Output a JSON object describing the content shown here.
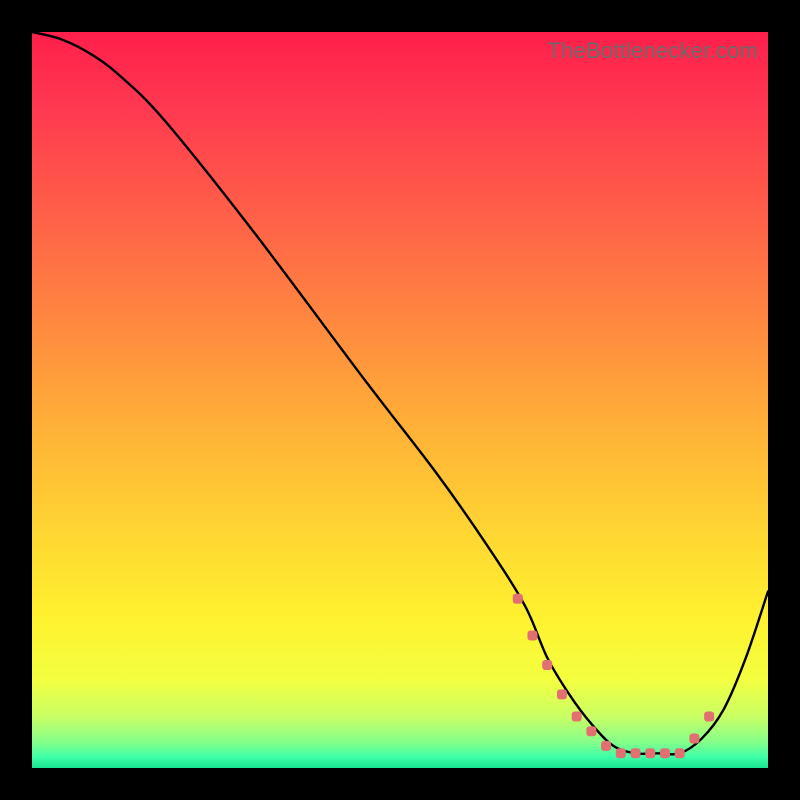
{
  "watermark": "TheBottlenecker.com",
  "gradient_stops": [
    {
      "offset": 0.0,
      "color": "#ff1f4b"
    },
    {
      "offset": 0.1,
      "color": "#ff3850"
    },
    {
      "offset": 0.25,
      "color": "#ff6048"
    },
    {
      "offset": 0.4,
      "color": "#ff8a3f"
    },
    {
      "offset": 0.55,
      "color": "#ffb437"
    },
    {
      "offset": 0.7,
      "color": "#ffdb32"
    },
    {
      "offset": 0.8,
      "color": "#fff22f"
    },
    {
      "offset": 0.88,
      "color": "#f3ff40"
    },
    {
      "offset": 0.93,
      "color": "#c9ff64"
    },
    {
      "offset": 0.965,
      "color": "#84ff8a"
    },
    {
      "offset": 0.985,
      "color": "#3effa7"
    },
    {
      "offset": 1.0,
      "color": "#18e38f"
    }
  ],
  "chart_data": {
    "type": "line",
    "title": "",
    "xlabel": "",
    "ylabel": "",
    "xlim": [
      0,
      100
    ],
    "ylim": [
      0,
      100
    ],
    "series": [
      {
        "name": "curve",
        "x": [
          0,
          4,
          8,
          12,
          18,
          30,
          45,
          55,
          62,
          67,
          70,
          73,
          76,
          79,
          82,
          85,
          88,
          91,
          94,
          97,
          100
        ],
        "values": [
          100,
          99,
          97,
          94,
          88,
          73,
          53,
          40,
          30,
          22,
          15,
          10,
          6,
          3,
          2,
          2,
          2,
          4,
          8,
          15,
          24
        ]
      }
    ],
    "markers": {
      "name": "dotted-segment",
      "color": "#e27070",
      "x": [
        66,
        68,
        70,
        72,
        74,
        76,
        78,
        80,
        82,
        84,
        86,
        88,
        90,
        92
      ],
      "values": [
        23,
        18,
        14,
        10,
        7,
        5,
        3,
        2,
        2,
        2,
        2,
        2,
        4,
        7
      ]
    }
  }
}
